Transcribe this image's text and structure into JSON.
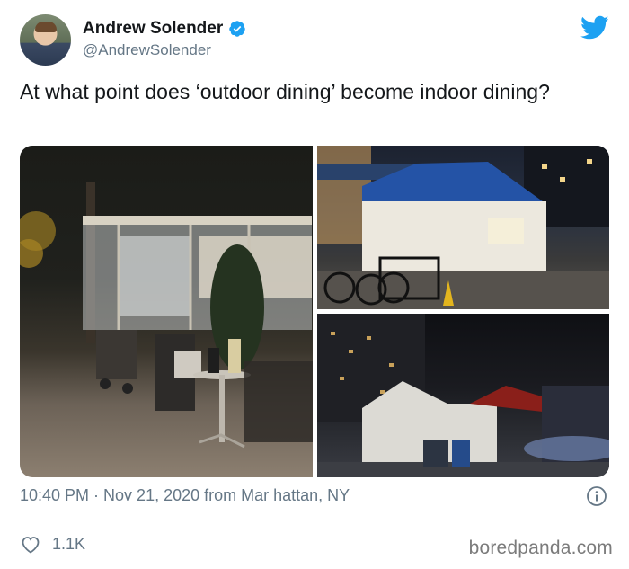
{
  "author": {
    "name": "Andrew Solender",
    "handle": "@AndrewSolender",
    "verified": true
  },
  "tweet": {
    "text": "At what point does ‘outdoor dining’ become indoor dining?"
  },
  "photos": [
    {
      "subject": "outdoor-dining-enclosure-photo"
    },
    {
      "subject": "blue-tent-photo"
    },
    {
      "subject": "night-street-tents-photo"
    }
  ],
  "meta": {
    "timestamp": "10:40 PM · Nov 21, 2020 from Mar hattan, NY"
  },
  "engagement": {
    "likes": "1.1K"
  },
  "watermark": "boredpanda.com",
  "colors": {
    "twitter_blue": "#1da1f2",
    "secondary_text": "#657786",
    "primary_text": "#14171a"
  },
  "icons": {
    "verified": "verified-badge-icon",
    "logo": "twitter-bird-icon",
    "info": "info-icon",
    "like": "heart-icon"
  }
}
